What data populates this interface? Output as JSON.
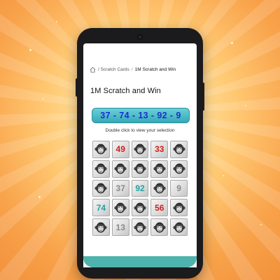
{
  "breadcrumb": {
    "home_icon": "home-icon",
    "items": [
      "/ Scratch Cards",
      "/",
      "1M Scratch and Win"
    ]
  },
  "page": {
    "title": "1M Scratch and Win",
    "selection_numbers": "37 - 74 - 13 - 92 - 9",
    "hint": "Double click to view your selection"
  },
  "colors": {
    "accent_teal": "#35a9b7",
    "number_blue": "#1b2fd0",
    "red": "#d0201f",
    "teal_text": "#21a3a3",
    "gray_text": "#8a8a8a"
  },
  "scratch_grid": [
    [
      {
        "type": "icon"
      },
      {
        "type": "number",
        "value": "49",
        "color": "red"
      },
      {
        "type": "icon"
      },
      {
        "type": "number",
        "value": "33",
        "color": "red"
      },
      {
        "type": "icon"
      }
    ],
    [
      {
        "type": "icon"
      },
      {
        "type": "icon"
      },
      {
        "type": "icon"
      },
      {
        "type": "icon"
      },
      {
        "type": "icon"
      }
    ],
    [
      {
        "type": "icon"
      },
      {
        "type": "number",
        "value": "37",
        "color": "gray"
      },
      {
        "type": "number",
        "value": "92",
        "color": "teal"
      },
      {
        "type": "icon"
      },
      {
        "type": "number",
        "value": "9",
        "color": "gray"
      }
    ],
    [
      {
        "type": "number",
        "value": "74",
        "color": "teal"
      },
      {
        "type": "icon"
      },
      {
        "type": "icon"
      },
      {
        "type": "number",
        "value": "56",
        "color": "red"
      },
      {
        "type": "icon"
      }
    ],
    [
      {
        "type": "icon"
      },
      {
        "type": "number",
        "value": "13",
        "color": "gray"
      },
      {
        "type": "icon"
      },
      {
        "type": "icon"
      },
      {
        "type": "icon"
      }
    ]
  ]
}
